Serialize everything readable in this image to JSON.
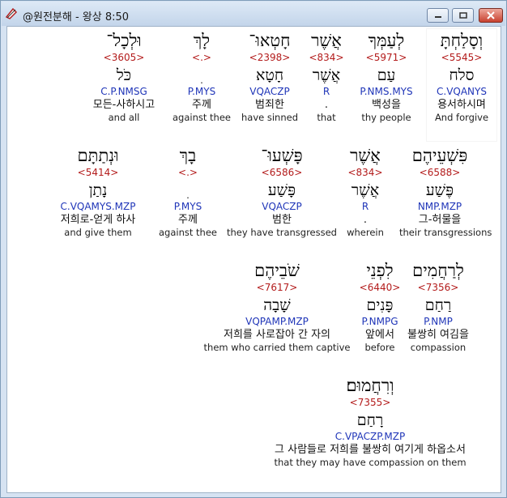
{
  "window": {
    "title": "@원전분해 - 왕상 8:50",
    "accent": "#1f35b8",
    "strong_color": "#b31b1b"
  },
  "controls": {
    "minimize": "minimize-icon",
    "maximize": "maximize-icon",
    "close": "close-icon"
  },
  "rows": [
    [
      {
        "hebrew": "וְסָלַחְתָּ",
        "strong": "<5545>",
        "lexeme": "סלח",
        "morph": "C.VQANYS",
        "korean": "용서하시며",
        "english": "And forgive"
      },
      {
        "hebrew": "לְעַמְּךָ",
        "strong": "<5971>",
        "lexeme": "עַם",
        "morph": "P.NMS.MYS",
        "korean": "백성을",
        "english": "thy people"
      },
      {
        "hebrew": "אֲשֶׁר",
        "strong": "<834>",
        "lexeme": "אֲשֶׁר",
        "morph": "R",
        "korean": ".",
        "english": "that"
      },
      {
        "hebrew": "חָטְאוּ־",
        "strong": "<2398>",
        "lexeme": "חָטָא",
        "morph": "VQACZP",
        "korean": "범죄한",
        "english": "have sinned"
      },
      {
        "hebrew": "לָךְ",
        "strong": "<.>",
        "lexeme": "ׅ",
        "morph": "P.MYS",
        "korean": "주께",
        "english": "against thee"
      },
      {
        "hebrew": "וּלְכָל־",
        "strong": "<3605>",
        "lexeme": "כֹּל",
        "morph": "C.P.NMSG",
        "korean": "모든-사하시고",
        "english": "and all"
      }
    ],
    [
      {
        "hebrew": "פִּשְׁעֵיהֶם",
        "strong": "<6588>",
        "lexeme": "פֶּשַׁע",
        "morph": "NMP.MZP",
        "korean": "그-허물을",
        "english": "their transgressions"
      },
      {
        "hebrew": "אֲשֶׁר",
        "strong": "<834>",
        "lexeme": "אֲשֶׁר",
        "morph": "R",
        "korean": ".",
        "english": "wherein"
      },
      {
        "hebrew": "פָּשְׁעוּ־",
        "strong": "<6586>",
        "lexeme": "פָּשַׁע",
        "morph": "VQACZP",
        "korean": "범한",
        "english": "they have transgressed"
      },
      {
        "hebrew": "בָךְ",
        "strong": "<.>",
        "lexeme": "ׅ",
        "morph": "P.MYS",
        "korean": "주께",
        "english": "against thee"
      },
      {
        "hebrew": "וּנְתַתָּם",
        "strong": "<5414>",
        "lexeme": "נָתַן",
        "morph": "C.VQAMYS.MZP",
        "korean": "저희로-얻게 하사",
        "english": "and give them"
      }
    ],
    [
      {
        "hebrew": "לְרַחֲמִים",
        "strong": "<7356>",
        "lexeme": "רַחַם",
        "morph": "P.NMP",
        "korean": "불쌍히 여김을",
        "english": "compassion"
      },
      {
        "hebrew": "לִפְנֵי",
        "strong": "<6440>",
        "lexeme": "פָּנִים",
        "morph": "P.NMPG",
        "korean": "앞에서",
        "english": "before"
      },
      {
        "hebrew": "שֹׁבֵיהֶם",
        "strong": "<7617>",
        "lexeme": "שָׁבָה",
        "morph": "VQPAMP.MZP",
        "korean": "저희를 사로잡아 간 자의",
        "english": "them who carried them captive"
      }
    ],
    [
      {
        "hebrew": "וְרִחֲמוּם׃",
        "strong": "<7355>",
        "lexeme": "רָחַם",
        "morph": "C.VPACZP.MZP",
        "korean": "그 사람들로 저희를 불쌍히 여기게 하옵소서",
        "english": "that they may have compassion on them"
      }
    ]
  ]
}
